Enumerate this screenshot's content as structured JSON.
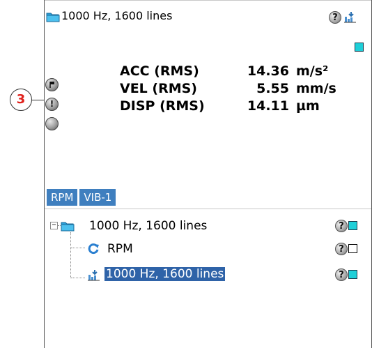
{
  "callout": {
    "number": "3"
  },
  "header": {
    "title": "1000 Hz, 1600 lines",
    "help_label": "?",
    "status_color": "#1ecfd8"
  },
  "side_buttons": [
    "flag",
    "!",
    ""
  ],
  "measurements": [
    {
      "label": "ACC (RMS)",
      "value": "14.36",
      "unit": "m/s²"
    },
    {
      "label": "VEL (RMS)",
      "value": "5.55",
      "unit": "mm/s"
    },
    {
      "label": "DISP (RMS)",
      "value": "14.11",
      "unit": "µm"
    }
  ],
  "tabs": [
    "RPM",
    "VIB-1"
  ],
  "tree": {
    "expander": "−",
    "root": {
      "label": "1000 Hz, 1600 lines",
      "icon": "folder-icon",
      "status": "active",
      "help_label": "?"
    },
    "children": [
      {
        "label": "RPM",
        "icon": "refresh-icon",
        "status": "inactive",
        "help_label": "?"
      },
      {
        "label": "1000 Hz, 1600 lines",
        "icon": "export-icon",
        "status": "active",
        "selected": true,
        "help_label": "?"
      }
    ]
  },
  "colors": {
    "accent": "#3f7fbf",
    "selection": "#2f63a8",
    "status_active": "#1ecfd8",
    "callout_text": "#e0201b"
  }
}
